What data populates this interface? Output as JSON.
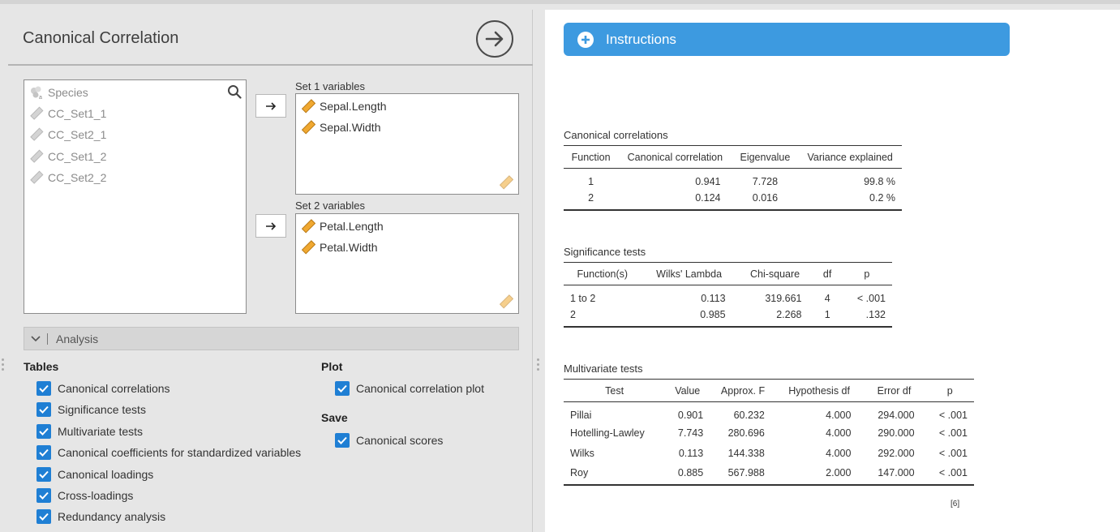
{
  "analysis": {
    "title": "Canonical Correlation",
    "source_variables": [
      "Species",
      "CC_Set1_1",
      "CC_Set2_1",
      "CC_Set1_2",
      "CC_Set2_2"
    ],
    "set1": {
      "label": "Set 1 variables",
      "variables": [
        "Sepal.Length",
        "Sepal.Width"
      ]
    },
    "set2": {
      "label": "Set 2 variables",
      "variables": [
        "Petal.Length",
        "Petal.Width"
      ]
    },
    "section_label": "Analysis",
    "tables_heading": "Tables",
    "tables_options": [
      "Canonical correlations",
      "Significance tests",
      "Multivariate tests",
      "Canonical coefficients for standardized variables",
      "Canonical loadings",
      "Cross-loadings",
      "Redundancy analysis"
    ],
    "plot_heading": "Plot",
    "plot_option": "Canonical correlation plot",
    "save_heading": "Save",
    "save_option": "Canonical scores"
  },
  "results": {
    "instructions_label": "Instructions",
    "canonical_correlations": {
      "title": "Canonical correlations",
      "columns": [
        "Function",
        "Canonical correlation",
        "Eigenvalue",
        "Variance explained"
      ],
      "rows": [
        [
          "1",
          "0.941",
          "7.728",
          "99.8 %"
        ],
        [
          "2",
          "0.124",
          "0.016",
          "0.2 %"
        ]
      ]
    },
    "significance_tests": {
      "title": "Significance tests",
      "columns": [
        "Function(s)",
        "Wilks' Lambda",
        "Chi-square",
        "df",
        "p"
      ],
      "rows": [
        [
          "1 to 2",
          "0.113",
          "319.661",
          "4",
          "< .001"
        ],
        [
          "2",
          "0.985",
          "2.268",
          "1",
          ".132"
        ]
      ]
    },
    "multivariate_tests": {
      "title": "Multivariate tests",
      "columns": [
        "Test",
        "Value",
        "Approx. F",
        "Hypothesis df",
        "Error df",
        "p"
      ],
      "rows": [
        [
          "Pillai",
          "0.901",
          "60.232",
          "4.000",
          "294.000",
          "< .001"
        ],
        [
          "Hotelling-Lawley",
          "7.743",
          "280.696",
          "4.000",
          "290.000",
          "< .001"
        ],
        [
          "Wilks",
          "0.113",
          "144.338",
          "4.000",
          "292.000",
          "< .001"
        ],
        [
          "Roy",
          "0.885",
          "567.988",
          "2.000",
          "147.000",
          "< .001"
        ]
      ]
    },
    "reference": "[6]"
  },
  "colors": {
    "accent": "#3d9ae0",
    "checkbox": "#1f7fd4",
    "scale_icon": "#f0a830"
  }
}
